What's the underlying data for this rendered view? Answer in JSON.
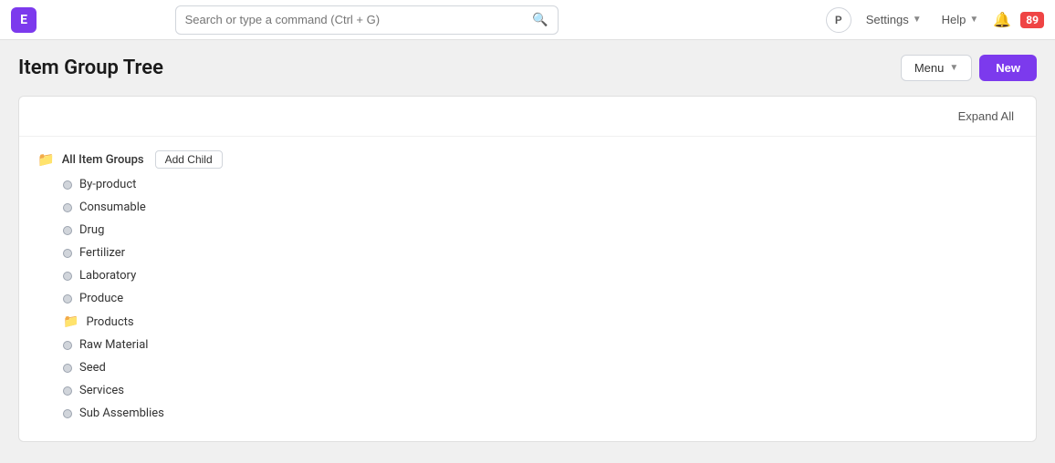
{
  "app": {
    "logo_letter": "E",
    "logo_color": "#7c3aed"
  },
  "navbar": {
    "search_placeholder": "Search or type a command (Ctrl + G)",
    "search_shortcut": "Ctrl + G",
    "p_label": "P",
    "settings_label": "Settings",
    "help_label": "Help",
    "notification_count": "89"
  },
  "page": {
    "title": "Item Group Tree",
    "menu_label": "Menu",
    "new_label": "New",
    "expand_all_label": "Expand All"
  },
  "tree": {
    "root_label": "All Item Groups",
    "add_child_label": "Add Child",
    "items": [
      {
        "label": "By-product",
        "type": "leaf"
      },
      {
        "label": "Consumable",
        "type": "leaf"
      },
      {
        "label": "Drug",
        "type": "leaf"
      },
      {
        "label": "Fertilizer",
        "type": "leaf"
      },
      {
        "label": "Laboratory",
        "type": "leaf"
      },
      {
        "label": "Produce",
        "type": "leaf"
      },
      {
        "label": "Products",
        "type": "folder"
      },
      {
        "label": "Raw Material",
        "type": "leaf"
      },
      {
        "label": "Seed",
        "type": "leaf"
      },
      {
        "label": "Services",
        "type": "leaf"
      },
      {
        "label": "Sub Assemblies",
        "type": "leaf"
      }
    ]
  }
}
